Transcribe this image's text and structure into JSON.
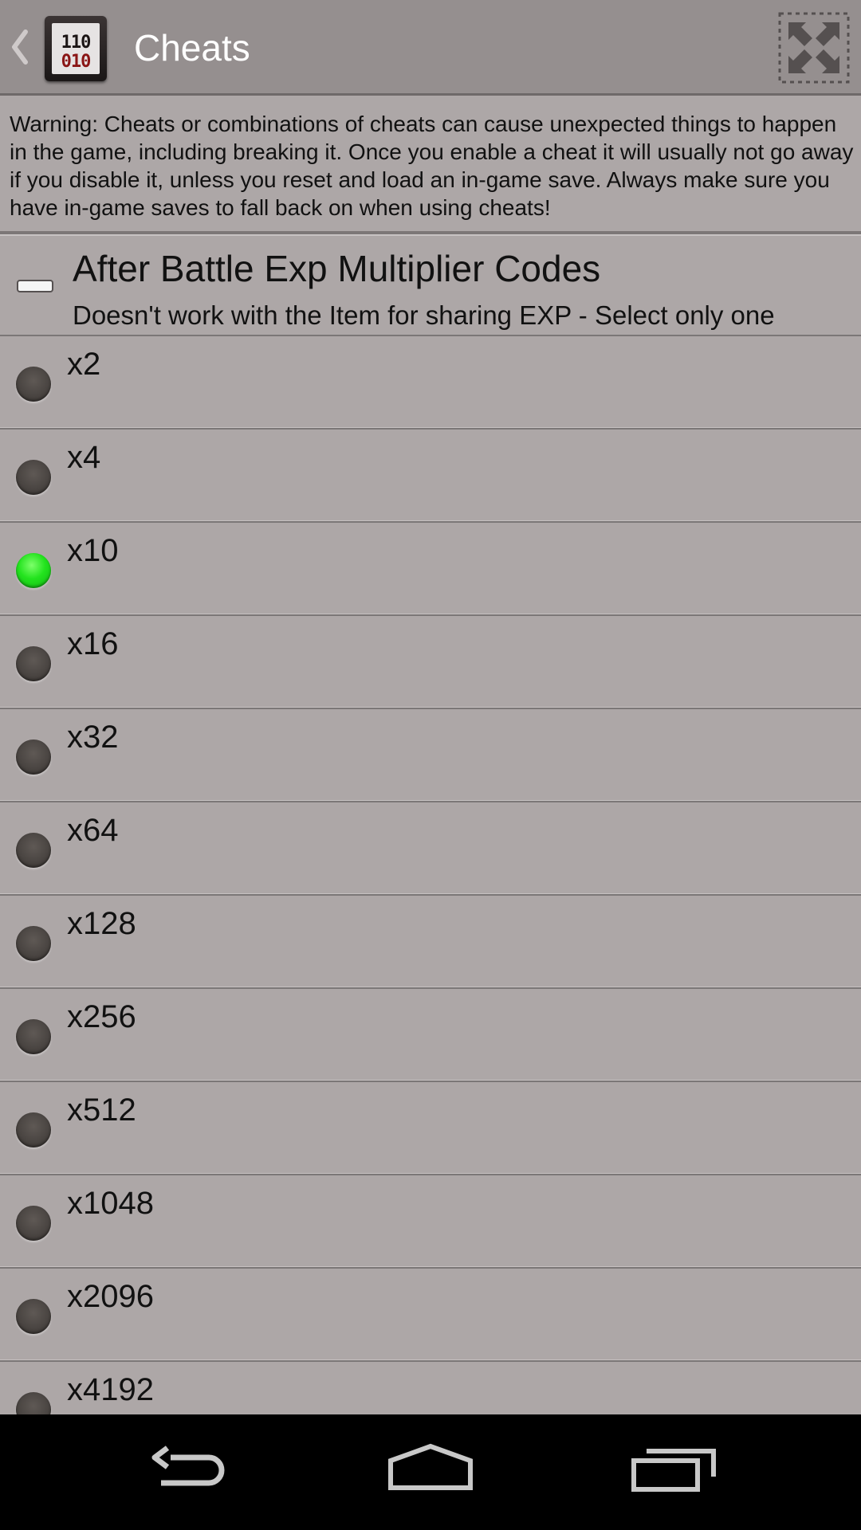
{
  "action_bar": {
    "title": "Cheats",
    "app_icon_text": [
      "110",
      "010"
    ]
  },
  "warning": {
    "text": "Warning: Cheats or combinations of cheats can cause unexpected things to happen in the game, including breaking it. Once you enable a cheat it will usually not go away if you disable it, unless you reset and load an in-game save. Always make sure you have in-game saves to fall back on when using cheats!"
  },
  "group": {
    "title": "After Battle Exp Multiplier Codes",
    "subtitle": "Doesn't work with the Item for sharing EXP - Select only one",
    "expanded": true
  },
  "options": [
    {
      "label": "x2",
      "selected": false
    },
    {
      "label": "x4",
      "selected": false
    },
    {
      "label": "x10",
      "selected": true
    },
    {
      "label": "x16",
      "selected": false
    },
    {
      "label": "x32",
      "selected": false
    },
    {
      "label": "x64",
      "selected": false
    },
    {
      "label": "x128",
      "selected": false
    },
    {
      "label": "x256",
      "selected": false
    },
    {
      "label": "x512",
      "selected": false
    },
    {
      "label": "x1048",
      "selected": false
    },
    {
      "label": "x2096",
      "selected": false
    },
    {
      "label": "x4192",
      "selected": false
    }
  ],
  "colors": {
    "background": "#ada7a7",
    "action_bar": "#958f8f",
    "selected_radio": "#23e31e",
    "unselected_radio": "#4a4542",
    "nav_bar": "#000000"
  },
  "icons": {
    "back": "chevron-left-icon",
    "fullscreen": "exit-fullscreen-icon",
    "nav": [
      "back-arrow-icon",
      "home-icon",
      "recent-apps-icon"
    ]
  }
}
